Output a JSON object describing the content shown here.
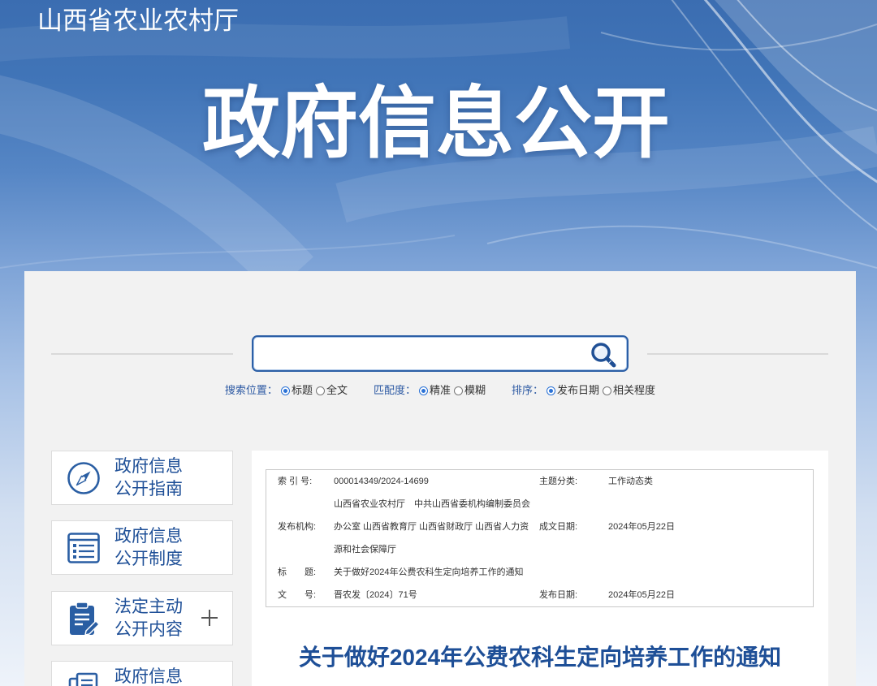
{
  "header": {
    "org_name": "山西省农业农村厅",
    "banner_title": "政府信息公开"
  },
  "search": {
    "value": "",
    "button_icon": "search-icon",
    "options": [
      {
        "label": "搜索位置：",
        "choices": [
          {
            "text": "标题",
            "checked": true
          },
          {
            "text": "全文",
            "checked": false
          }
        ]
      },
      {
        "label": "匹配度：",
        "choices": [
          {
            "text": "精准",
            "checked": true
          },
          {
            "text": "模糊",
            "checked": false
          }
        ]
      },
      {
        "label": "排序：",
        "choices": [
          {
            "text": "发布日期",
            "checked": true
          },
          {
            "text": "相关程度",
            "checked": false
          }
        ]
      }
    ]
  },
  "sidebar": {
    "items": [
      {
        "lines": [
          "政府信息",
          "公开指南"
        ],
        "icon": "compass-icon"
      },
      {
        "lines": [
          "政府信息",
          "公开制度"
        ],
        "icon": "list-icon"
      },
      {
        "lines": [
          "法定主动",
          "公开内容"
        ],
        "icon": "clipboard-edit-icon",
        "expand_icon": "plus-icon"
      },
      {
        "lines": [
          "政府信息"
        ],
        "icon": "documents-icon"
      }
    ]
  },
  "document": {
    "meta": {
      "index_no": {
        "label": "索 引 号:",
        "value": "000014349/2024-14699"
      },
      "topic": {
        "label": "主题分类:",
        "value": "工作动态类"
      },
      "publisher": {
        "label": "发布机构:",
        "value_lines": [
          "山西省农业农村厅　中共山西省委机构编制委员会",
          "办公室 山西省教育厅 山西省财政厅 山西省人力资",
          "源和社会保障厅"
        ]
      },
      "written_date": {
        "label": "成文日期:",
        "value": "2024年05月22日"
      },
      "title": {
        "label": "标　　题:",
        "value": "关于做好2024年公费农科生定向培养工作的通知"
      },
      "doc_no": {
        "label": "文　　号:",
        "value": "晋农发〔2024〕71号"
      },
      "publish_date": {
        "label": "发布日期:",
        "value": "2024年05月22日"
      }
    },
    "heading": "关于做好2024年公费农科生定向培养工作的通知"
  },
  "theme": {
    "brand_blue": "#1e4f97",
    "search_border": "#2c5fa6",
    "radio_checked": "#2b72d6"
  }
}
